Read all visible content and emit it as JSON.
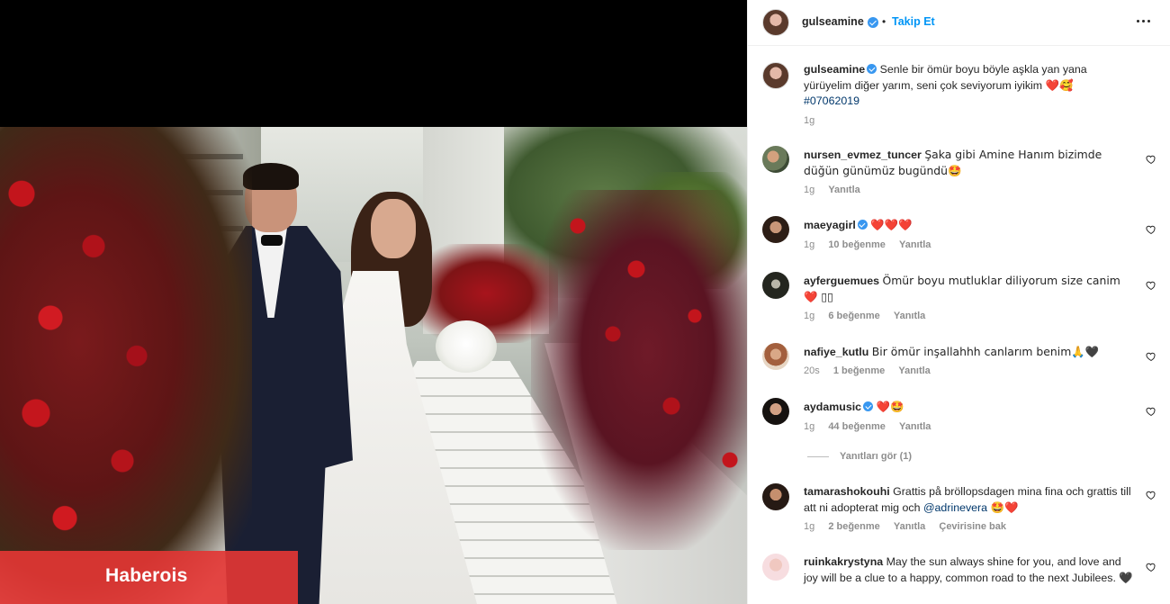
{
  "photo": {
    "watermark": "Haberois"
  },
  "header": {
    "username": "gulseamine",
    "separator": "•",
    "follow_label": "Takip Et",
    "more_icon": "more-horizontal-icon"
  },
  "caption": {
    "username": "gulseamine",
    "text": "Senle bir ömür boyu böyle aşkla yan yana yürüyelim diğer yarım, seni çok seviyorum iyikim",
    "emoji": "❤️🥰",
    "hashtag": "#07062019",
    "time": "1g"
  },
  "comments": [
    {
      "username": "nursen_evmez_tuncer",
      "verified": false,
      "text": "Şaka gibi Amine Hanım bizimde düğün günümüz bugündü🤩",
      "time": "1g",
      "likes": "",
      "reply": "Yanıtla",
      "translate": ""
    },
    {
      "username": "maeyagirl",
      "verified": true,
      "text": "❤️❤️❤️",
      "time": "1g",
      "likes": "10 beğenme",
      "reply": "Yanıtla",
      "translate": ""
    },
    {
      "username": "ayferguemues",
      "verified": false,
      "text": "Ömür boyu mutluklar diliyorum size canim ❤️ ▯▯",
      "time": "1g",
      "likes": "6 beğenme",
      "reply": "Yanıtla",
      "translate": ""
    },
    {
      "username": "nafiye_kutlu",
      "verified": false,
      "text": "Bir ömür inşallahhh canlarım benim🙏🖤",
      "time": "20s",
      "likes": "1 beğenme",
      "reply": "Yanıtla",
      "translate": ""
    },
    {
      "username": "aydamusic",
      "verified": true,
      "text": "❤️🤩",
      "time": "1g",
      "likes": "44 beğenme",
      "reply": "Yanıtla",
      "translate": ""
    },
    {
      "username": "tamarashokouhi",
      "verified": false,
      "text": "Grattis på bröllopsdagen mina fina och grattis till att ni adopterat mig och",
      "mention": "@adrinevera",
      "text_after": "🤩❤️",
      "time": "1g",
      "likes": "2 beğenme",
      "reply": "Yanıtla",
      "translate": "Çevirisine bak"
    },
    {
      "username": "ruinkakrystyna",
      "verified": false,
      "text": "May the sun always shine for you, and love and joy will be a clue to a happy, common road to the next Jubilees.",
      "text_after": "🖤",
      "time": "",
      "likes": "",
      "reply": "",
      "translate": ""
    }
  ],
  "view_replies": "Yanıtları gör (1)",
  "colors": {
    "accent": "#0095f6",
    "verified": "#3897f0",
    "watermark_bg": "#e23634",
    "muted_text": "#8e8e8e"
  }
}
